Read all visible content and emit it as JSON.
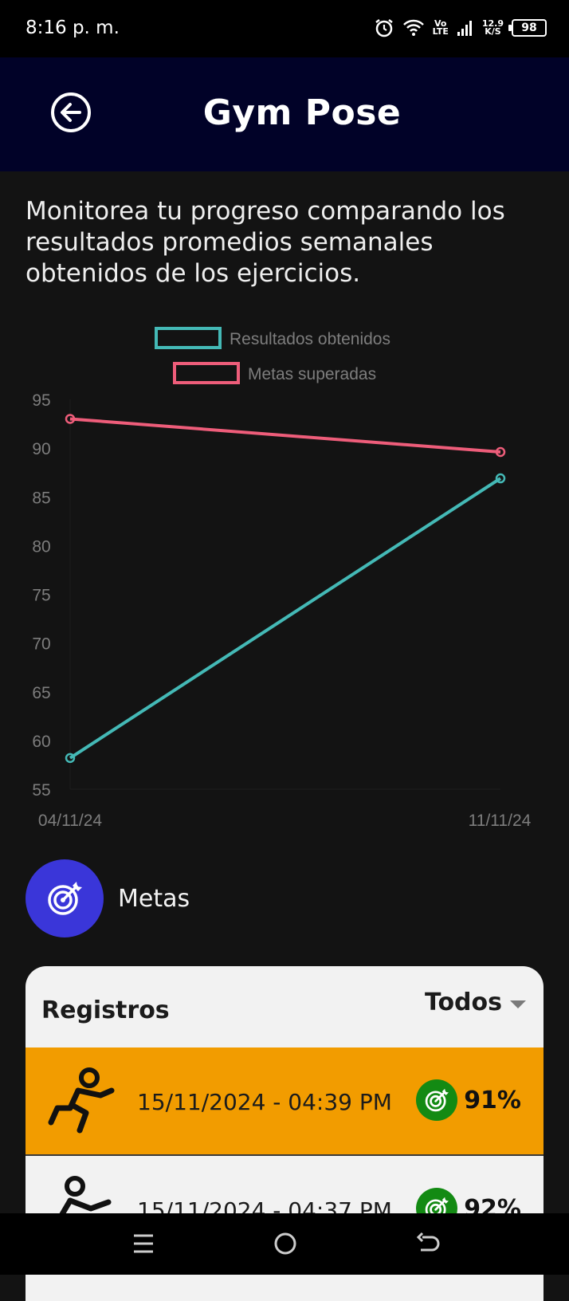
{
  "status_bar": {
    "time": "8:16 p. m.",
    "network_top": "Vo",
    "network_bottom": "LTE",
    "speed_value": "12.9",
    "speed_unit": "K/S",
    "battery": "98",
    "icons": [
      "alarm-icon",
      "wifi-icon",
      "signal-icon"
    ]
  },
  "app_bar": {
    "title": "Gym Pose",
    "back_icon": "arrow-left-circle-icon"
  },
  "description": "Monitorea tu progreso comparando los resultados promedios semanales obtenidos de los ejercicios.",
  "chart_data": {
    "type": "line",
    "x": [
      "04/11/24",
      "11/11/24"
    ],
    "series": [
      {
        "name": "Resultados obtenidos",
        "color": "#44b9b6",
        "values": [
          58.2,
          86.9
        ]
      },
      {
        "name": "Metas superadas",
        "color": "#ee5d7a",
        "values": [
          93,
          89.6
        ]
      }
    ],
    "ylim": [
      55,
      95
    ],
    "yticks": [
      95,
      90,
      85,
      80,
      75,
      70,
      65,
      60,
      55
    ],
    "legend": "top",
    "grid": false
  },
  "metas": {
    "label": "Metas",
    "icon": "target-icon",
    "color": "#3a36d9"
  },
  "registros": {
    "title": "Registros",
    "filter": "Todos",
    "rows": [
      {
        "date": "15/11/2024 - 04:39 PM",
        "score": "91%",
        "highlighted": true,
        "icon": "exercise-figure-icon"
      },
      {
        "date": "15/11/2024 - 04:37 PM",
        "score": "92%",
        "highlighted": false,
        "icon": "exercise-figure-icon"
      }
    ],
    "highlight_color": "#f29c00",
    "badge_color": "#138a13"
  },
  "nav_bar": {
    "icons": [
      "menu-icon",
      "home-circle-icon",
      "back-arrow-icon"
    ]
  }
}
